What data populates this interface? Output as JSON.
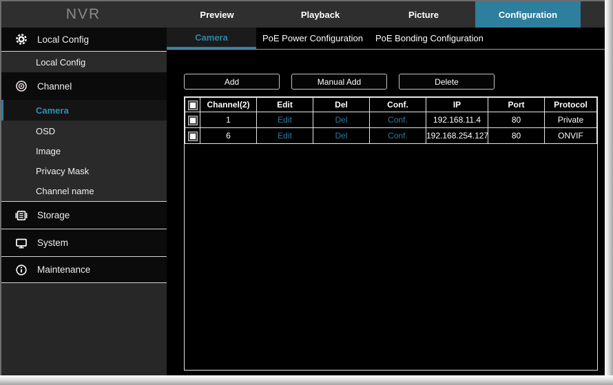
{
  "app": {
    "logo": "NVR"
  },
  "topnav": {
    "items": [
      {
        "label": "Preview",
        "active": false
      },
      {
        "label": "Playback",
        "active": false
      },
      {
        "label": "Picture",
        "active": false
      },
      {
        "label": "Configuration",
        "active": true
      }
    ]
  },
  "subtabs": {
    "items": [
      {
        "label": "Camera",
        "active": true
      },
      {
        "label": "PoE Power Configuration",
        "active": false
      },
      {
        "label": "PoE Bonding Configuration",
        "active": false
      }
    ]
  },
  "sidebar": {
    "items": [
      {
        "label": "Local Config",
        "type": "top",
        "icon": "gear-icon"
      },
      {
        "label": "Local Config",
        "type": "sub",
        "active": false
      },
      {
        "label": "Channel",
        "type": "top",
        "icon": "lens-icon"
      },
      {
        "label": "Camera",
        "type": "sub",
        "active": true
      },
      {
        "label": "OSD",
        "type": "sub",
        "active": false
      },
      {
        "label": "Image",
        "type": "sub",
        "active": false
      },
      {
        "label": "Privacy Mask",
        "type": "sub",
        "active": false
      },
      {
        "label": "Channel name",
        "type": "sub",
        "active": false
      },
      {
        "label": "Storage",
        "type": "top",
        "icon": "storage-icon"
      },
      {
        "label": "System",
        "type": "top",
        "icon": "monitor-icon"
      },
      {
        "label": "Maintenance",
        "type": "top",
        "icon": "info-icon"
      }
    ]
  },
  "toolbar": {
    "buttons": [
      {
        "label": "Add"
      },
      {
        "label": "Manual Add"
      },
      {
        "label": "Delete"
      }
    ]
  },
  "table": {
    "headers": {
      "channel": "Channel(2)",
      "edit": "Edit",
      "del": "Del",
      "conf": "Conf.",
      "ip": "IP",
      "port": "Port",
      "protocol": "Protocol"
    },
    "rows": [
      {
        "channel": "1",
        "edit": "Edit",
        "del": "Del",
        "conf": "Conf.",
        "ip": "192.168.11.4",
        "port": "80",
        "protocol": "Private"
      },
      {
        "channel": "6",
        "edit": "Edit",
        "del": "Del",
        "conf": "Conf.",
        "ip": "192.168.254.127",
        "port": "80",
        "protocol": "ONVIF"
      }
    ],
    "checkboxes_checked": false
  },
  "colors": {
    "accent": "#2e7e9d",
    "accent_text": "#2e86ac",
    "link": "#2a7da0",
    "topbar": "#2f2f2f"
  }
}
